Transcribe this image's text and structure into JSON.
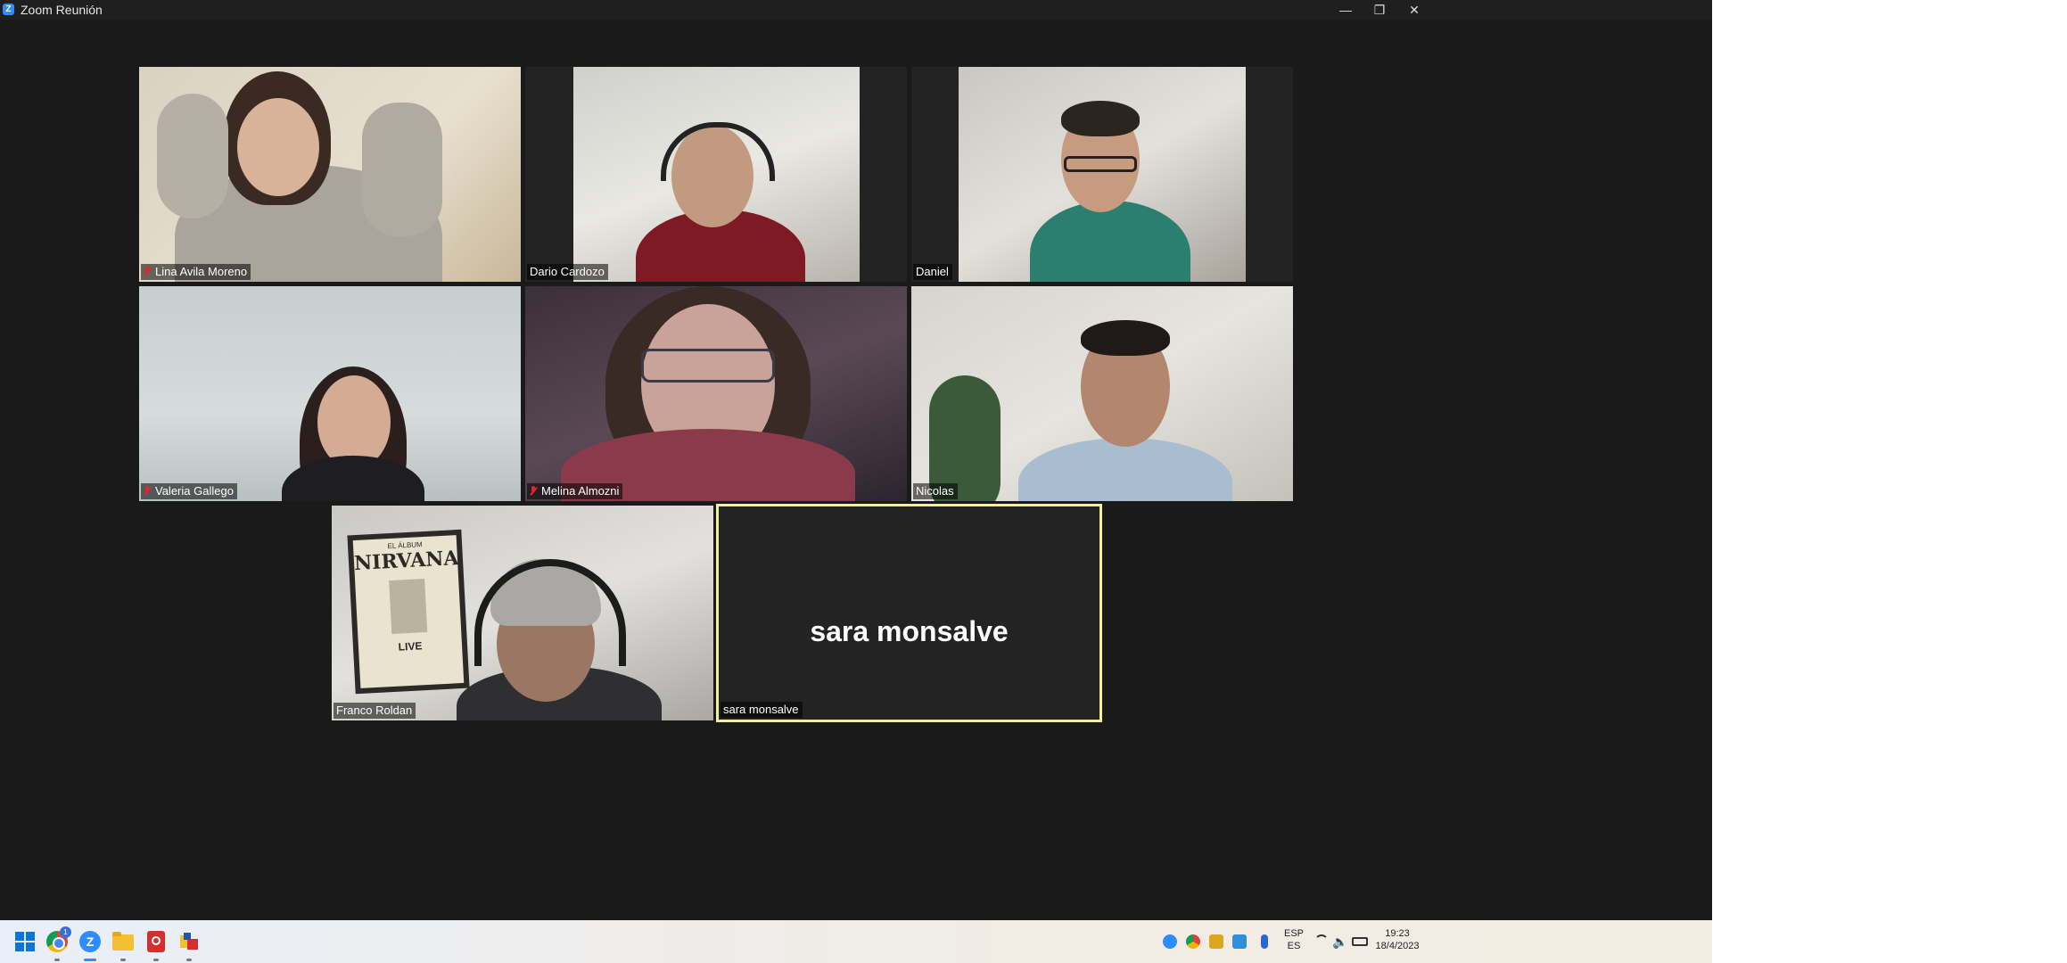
{
  "window": {
    "title": "Zoom Reunión",
    "minimize_glyph": "—",
    "restore_glyph": "❐",
    "close_glyph": "✕"
  },
  "participants": [
    {
      "name": "Lina Avila Moreno",
      "muted": true
    },
    {
      "name": "Dario Cardozo",
      "muted": false
    },
    {
      "name": "Daniel",
      "muted": false
    },
    {
      "name": "Valeria Gallego",
      "muted": true
    },
    {
      "name": "Melina Almozni",
      "muted": true
    },
    {
      "name": "Nicolas",
      "muted": false
    },
    {
      "name": "Franco Roldan",
      "muted": false
    },
    {
      "name": "sara monsalve",
      "muted": false,
      "camera_off": true,
      "active_speaker": true
    }
  ],
  "poster": {
    "line1": "EL ÁLBUM",
    "line2": "NIRVANA",
    "line3": "LIVE"
  },
  "taskbar": {
    "icons": [
      "windows-start-icon",
      "chrome-icon",
      "zoom-icon",
      "file-explorer-icon",
      "acrobat-icon",
      "app-icon"
    ],
    "chrome_badge": "1",
    "tray": {
      "lang_top": "ESP",
      "lang_bottom": "ES",
      "time": "19:23",
      "date": "18/4/2023"
    }
  },
  "colors": {
    "background": "#1a1a1a",
    "active_border": "#f2f0a0",
    "zoom_blue": "#2d8cff",
    "mute_red": "#e02828"
  }
}
